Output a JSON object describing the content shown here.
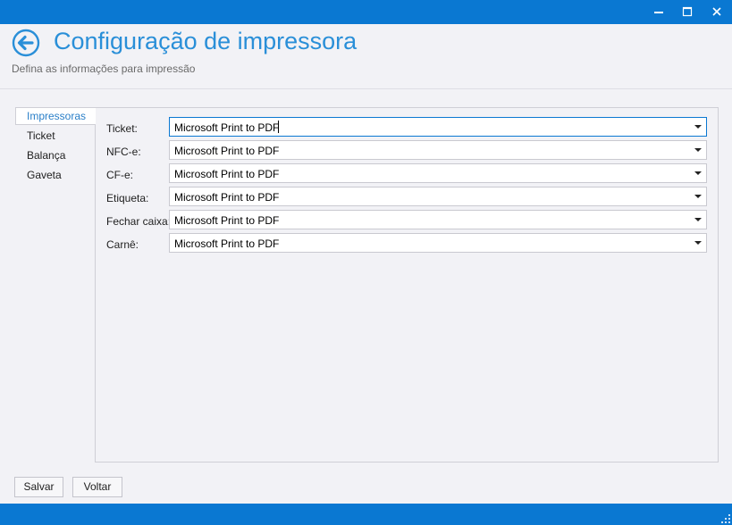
{
  "window": {
    "accent_color": "#0a78d2",
    "controls": [
      "minimize-icon",
      "maximize-icon",
      "close-icon"
    ]
  },
  "header": {
    "title": "Configuração de impressora",
    "subtitle": "Defina as informações para impressão",
    "back_icon": "arrow-left-circle-icon",
    "title_color": "#2a8fd8"
  },
  "nav": {
    "items": [
      {
        "label": "Impressoras",
        "active": true
      },
      {
        "label": "Ticket",
        "active": false
      },
      {
        "label": "Balança",
        "active": false
      },
      {
        "label": "Gaveta",
        "active": false
      }
    ]
  },
  "printers": {
    "fields": [
      {
        "label": "Ticket:",
        "value": "Microsoft Print to PDF"
      },
      {
        "label": "NFC-e:",
        "value": "Microsoft Print to PDF"
      },
      {
        "label": "CF-e:",
        "value": "Microsoft Print to PDF"
      },
      {
        "label": "Etiqueta:",
        "value": "Microsoft Print to PDF"
      },
      {
        "label": "Fechar caixa:",
        "value": "Microsoft Print to PDF"
      },
      {
        "label": "Carnê:",
        "value": "Microsoft Print to PDF"
      }
    ]
  },
  "buttons": {
    "save_label": "Salvar",
    "back_label": "Voltar"
  }
}
